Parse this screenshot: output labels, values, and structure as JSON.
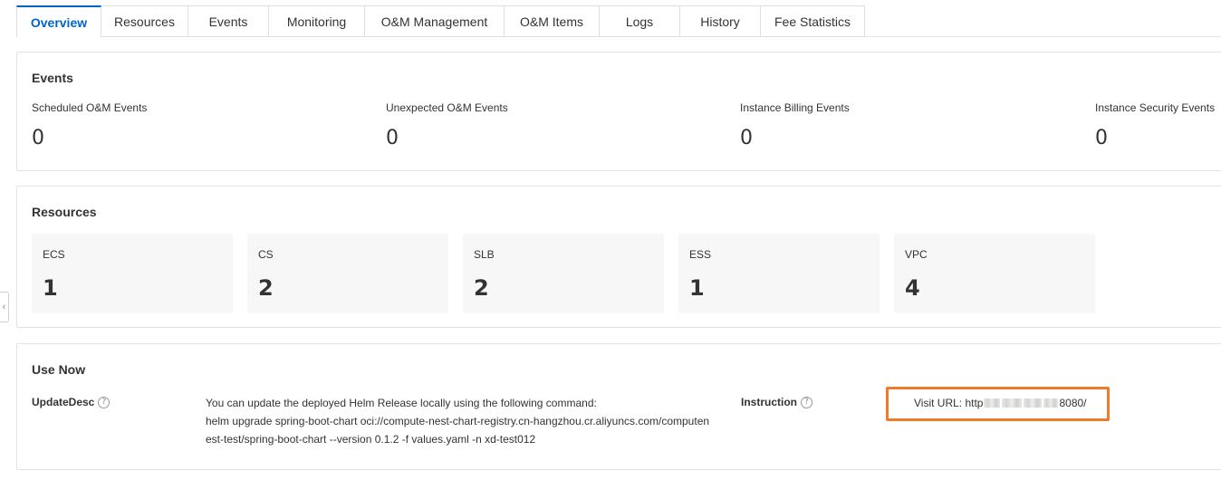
{
  "tabs": [
    {
      "label": "Overview",
      "active": true
    },
    {
      "label": "Resources"
    },
    {
      "label": "Events"
    },
    {
      "label": "Monitoring"
    },
    {
      "label": "O&M Management"
    },
    {
      "label": "O&M Items"
    },
    {
      "label": "Logs"
    },
    {
      "label": "History"
    },
    {
      "label": "Fee Statistics"
    }
  ],
  "events": {
    "title": "Events",
    "items": [
      {
        "label": "Scheduled O&M Events",
        "value": "0"
      },
      {
        "label": "Unexpected O&M Events",
        "value": "0"
      },
      {
        "label": "Instance Billing Events",
        "value": "0"
      },
      {
        "label": "Instance Security Events",
        "value": "0"
      }
    ]
  },
  "resources": {
    "title": "Resources",
    "items": [
      {
        "label": "ECS",
        "value": "1"
      },
      {
        "label": "CS",
        "value": "2"
      },
      {
        "label": "SLB",
        "value": "2"
      },
      {
        "label": "ESS",
        "value": "1"
      },
      {
        "label": "VPC",
        "value": "4"
      }
    ]
  },
  "use_now": {
    "title": "Use Now",
    "update_desc_key": "UpdateDesc",
    "update_desc_lines": [
      "You can update the deployed Helm Release locally using the following command:",
      "helm upgrade spring-boot-chart oci://compute-nest-chart-registry.cn-hangzhou.cr.aliyuncs.com/computen",
      "est-test/spring-boot-chart --version 0.1.2 -f values.yaml -n xd-test012"
    ],
    "instruction_key": "Instruction",
    "visit_url_prefix": "Visit URL: http",
    "visit_url_suffix": "8080/",
    "highlight_color": "#f07c2a"
  },
  "icons": {
    "help": "question-circle-icon",
    "collapse": "chevron-left-icon"
  },
  "colors": {
    "accent": "#0064c8",
    "highlight": "#f07c2a"
  }
}
